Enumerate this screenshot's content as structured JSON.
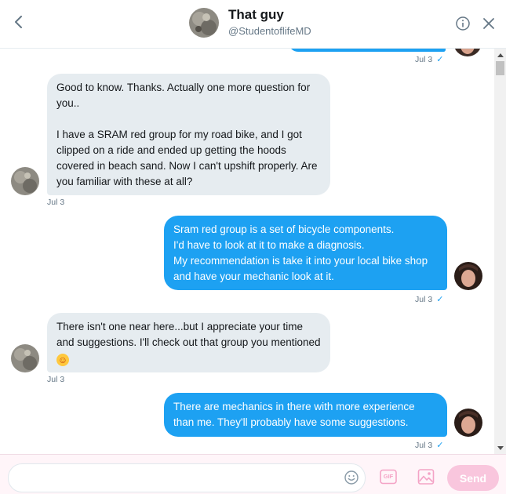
{
  "header": {
    "name": "That guy",
    "handle": "@StudentoflifeMD",
    "back_icon": "chevron-left-icon",
    "info_icon": "info-circle-icon",
    "close_icon": "close-icon"
  },
  "messages": [
    {
      "direction": "out",
      "text": "",
      "timestamp": "Jul 3",
      "status": "✓"
    },
    {
      "direction": "in",
      "text": "Good to know. Thanks. Actually one more question for you..\n\nI have a SRAM red group for my road bike, and I got clipped on a ride and ended up getting the hoods covered in beach sand. Now I can't upshift properly. Are you familiar with these at all?",
      "timestamp": "Jul 3"
    },
    {
      "direction": "out",
      "text": "Sram red group is a set of bicycle components.\nI'd have to look at it to make a diagnosis.\nMy recommendation is take it into your local bike shop and have your mechanic look at it.",
      "timestamp": "Jul 3",
      "status": "✓"
    },
    {
      "direction": "in",
      "text": "There isn't one near here...but I appreciate your time and suggestions. I'll check out that group you mentioned",
      "emoji": "☺",
      "timestamp": "Jul 3"
    },
    {
      "direction": "out",
      "text": "There are mechanics in there with more experience than me. They'll probably have some suggestions.",
      "timestamp": "Jul 3",
      "status": "✓"
    }
  ],
  "composer": {
    "placeholder": "",
    "emoji_icon": "smiley-icon",
    "gif_label": "GIF",
    "media_icon": "image-icon",
    "send_label": "Send"
  },
  "colors": {
    "outgoing_bubble": "#1da1f2",
    "incoming_bubble": "#e6ecf0",
    "send_button": "#f9c6dd",
    "composer_icons": "#f4a3c6"
  }
}
